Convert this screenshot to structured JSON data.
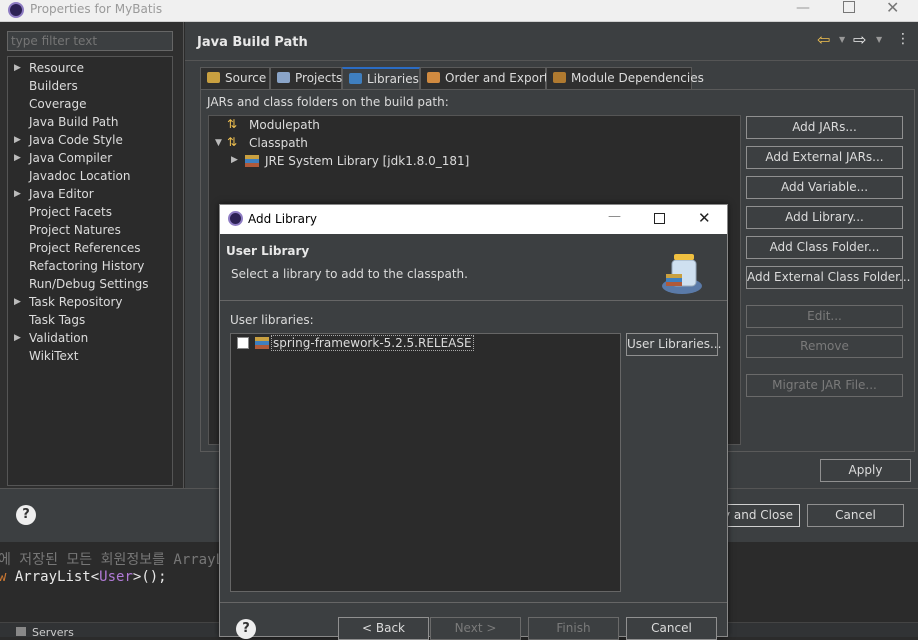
{
  "window": {
    "title": "Properties for MyBatis"
  },
  "filter": {
    "placeholder": "type filter text"
  },
  "nav": {
    "items": [
      {
        "label": "Resource",
        "expandable": true
      },
      {
        "label": "Builders",
        "expandable": false
      },
      {
        "label": "Coverage",
        "expandable": false
      },
      {
        "label": "Java Build Path",
        "expandable": false
      },
      {
        "label": "Java Code Style",
        "expandable": true
      },
      {
        "label": "Java Compiler",
        "expandable": true
      },
      {
        "label": "Javadoc Location",
        "expandable": false
      },
      {
        "label": "Java Editor",
        "expandable": true
      },
      {
        "label": "Project Facets",
        "expandable": false
      },
      {
        "label": "Project Natures",
        "expandable": false
      },
      {
        "label": "Project References",
        "expandable": false
      },
      {
        "label": "Refactoring History",
        "expandable": false
      },
      {
        "label": "Run/Debug Settings",
        "expandable": false
      },
      {
        "label": "Task Repository",
        "expandable": true
      },
      {
        "label": "Task Tags",
        "expandable": false
      },
      {
        "label": "Validation",
        "expandable": true
      },
      {
        "label": "WikiText",
        "expandable": false
      }
    ]
  },
  "page": {
    "title": "Java Build Path",
    "tabs": [
      "Source",
      "Projects",
      "Libraries",
      "Order and Export",
      "Module Dependencies"
    ],
    "active_tab": "Libraries",
    "desc": "JARs and class folders on the build path:",
    "tree": {
      "modulepath": "Modulepath",
      "classpath": "Classpath",
      "jre": "JRE System Library [jdk1.8.0_181]"
    },
    "buttons": {
      "add_jars": "Add JARs...",
      "add_external_jars": "Add External JARs...",
      "add_variable": "Add Variable...",
      "add_library": "Add Library...",
      "add_class_folder": "Add Class Folder...",
      "add_external_class_folder": "Add External Class Folder...",
      "edit": "Edit...",
      "remove": "Remove",
      "migrate": "Migrate JAR File..."
    },
    "apply": "Apply",
    "apply_and_close": "ly and Close",
    "cancel": "Cancel"
  },
  "editor": {
    "line1": "에 저장된 모든 회원정보를 ArrayL",
    "line2_kw": "w",
    "line2_type": "ArrayList",
    "line2_lt": "<",
    "line2_gen": "User",
    "line2_rest": ">();"
  },
  "servers_tab": "Servers",
  "dialog": {
    "title": "Add Library",
    "heading": "User Library",
    "subtitle": "Select a library to add to the classpath.",
    "list_label": "User libraries:",
    "libraries": [
      {
        "label": "spring-framework-5.2.5.RELEASE",
        "checked": false
      }
    ],
    "user_libraries_button": "User Libraries...",
    "back": "< Back",
    "next": "Next >",
    "finish": "Finish",
    "cancel": "Cancel"
  },
  "colors": {
    "accent": "#2b6cc4",
    "bg": "#2b2b2b",
    "panel": "#3c3f41"
  }
}
